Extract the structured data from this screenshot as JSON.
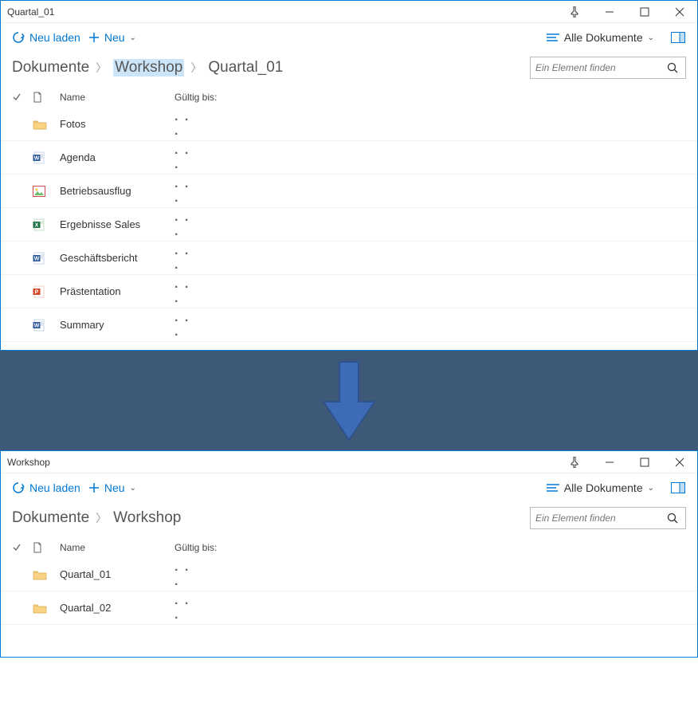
{
  "window1": {
    "title": "Quartal_01",
    "toolbar": {
      "reload_label": "Neu laden",
      "new_label": "Neu",
      "view_label": "Alle Dokumente"
    },
    "breadcrumb": {
      "items": [
        "Dokumente",
        "Workshop",
        "Quartal_01"
      ],
      "selected_index": 1
    },
    "search": {
      "placeholder": "Ein Element finden"
    },
    "columns": {
      "name": "Name",
      "valid_until": "Gültig bis:"
    },
    "files": [
      {
        "name": "Fotos",
        "type": "folder"
      },
      {
        "name": "Agenda",
        "type": "word"
      },
      {
        "name": "Betriebsausflug",
        "type": "image"
      },
      {
        "name": "Ergebnisse Sales",
        "type": "excel"
      },
      {
        "name": "Geschäftsbericht",
        "type": "word"
      },
      {
        "name": "Prästentation",
        "type": "powerpoint"
      },
      {
        "name": "Summary",
        "type": "word"
      }
    ]
  },
  "window2": {
    "title": "Workshop",
    "toolbar": {
      "reload_label": "Neu laden",
      "new_label": "Neu",
      "view_label": "Alle Dokumente"
    },
    "breadcrumb": {
      "items": [
        "Dokumente",
        "Workshop"
      ],
      "selected_index": -1
    },
    "search": {
      "placeholder": "Ein Element finden"
    },
    "columns": {
      "name": "Name",
      "valid_until": "Gültig bis:"
    },
    "files": [
      {
        "name": "Quartal_01",
        "type": "folder"
      },
      {
        "name": "Quartal_02",
        "type": "folder"
      }
    ]
  },
  "ellipsis": ". . ."
}
